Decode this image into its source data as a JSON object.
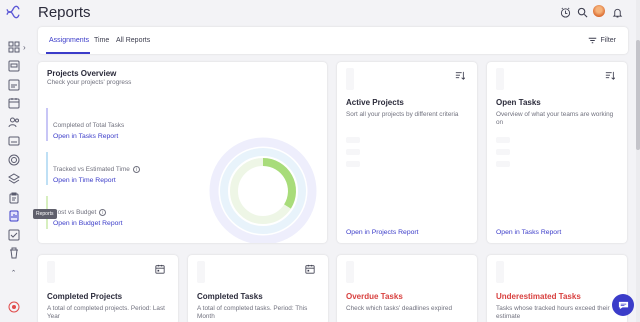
{
  "header": {
    "title": "Reports"
  },
  "sidebar": {
    "tooltip": "Reports"
  },
  "tabs": [
    {
      "label": "Assignments",
      "active": true
    },
    {
      "label": "Time",
      "active": false
    },
    {
      "label": "All Reports",
      "active": false
    }
  ],
  "filter_label": "Filter",
  "projects_overview": {
    "title": "Projects Overview",
    "subtitle": "Check your projects' progress",
    "metrics": [
      {
        "label": "Completed of Total Tasks",
        "link": "Open in Tasks Report"
      },
      {
        "label": "Tracked vs Estimated Time",
        "link": "Open in Time Report"
      },
      {
        "label": "Cost vs Budget",
        "link": "Open in Budget Report"
      }
    ]
  },
  "active_projects": {
    "title": "Active Projects",
    "desc": "Sort all your projects by different criteria",
    "link": "Open in Projects Report"
  },
  "open_tasks": {
    "title": "Open Tasks",
    "desc": "Overview of what your teams are working on",
    "link": "Open in Tasks Report"
  },
  "completed_projects": {
    "title": "Completed Projects",
    "desc": "A total of completed projects. Period: Last Year"
  },
  "completed_tasks": {
    "title": "Completed Tasks",
    "desc": "A total of completed tasks. Period: This Month"
  },
  "overdue_tasks": {
    "title": "Overdue Tasks",
    "desc": "Check which tasks' deadlines expired"
  },
  "underestimated_tasks": {
    "title": "Underestimated Tasks",
    "desc": "Tasks whose tracked hours exceed their estimate"
  },
  "colors": {
    "accent": "#3b3cc9",
    "danger": "#d8403f",
    "ring_green": "#a8dc7a"
  },
  "icons": [
    "logo-icon",
    "grid-icon",
    "board-icon",
    "calendar-icon",
    "people-icon",
    "target-icon",
    "layers-icon",
    "clipboard-icon",
    "reports-icon",
    "checklist-icon",
    "trash-icon",
    "alarm-icon",
    "search-icon",
    "bell-icon",
    "filter-icon",
    "sort-icon",
    "chat-icon"
  ]
}
